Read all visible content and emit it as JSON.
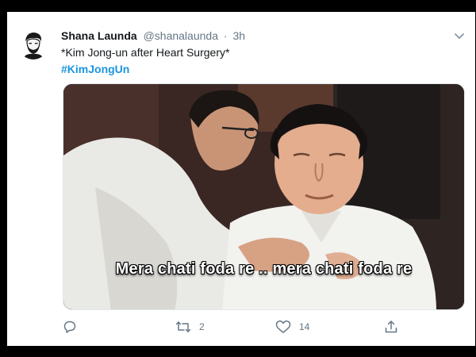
{
  "tweet": {
    "display_name": "Shana Launda",
    "handle": "@shanalaunda",
    "separator": "·",
    "timestamp": "3h",
    "text": "*Kim Jong-un after Heart Surgery*",
    "hashtag": "#KimJongUn"
  },
  "media": {
    "subtitle": "Mera chati foda re .. mera chati foda re"
  },
  "actions": {
    "reply_count": "",
    "retweet_count": "2",
    "like_count": "14"
  },
  "colors": {
    "link": "#1b95e0",
    "secondary_text": "#657786",
    "primary_text": "#14171a"
  },
  "icons": [
    "avatar-illustration",
    "chevron-down-icon",
    "reply-icon",
    "retweet-icon",
    "like-icon",
    "share-icon"
  ]
}
